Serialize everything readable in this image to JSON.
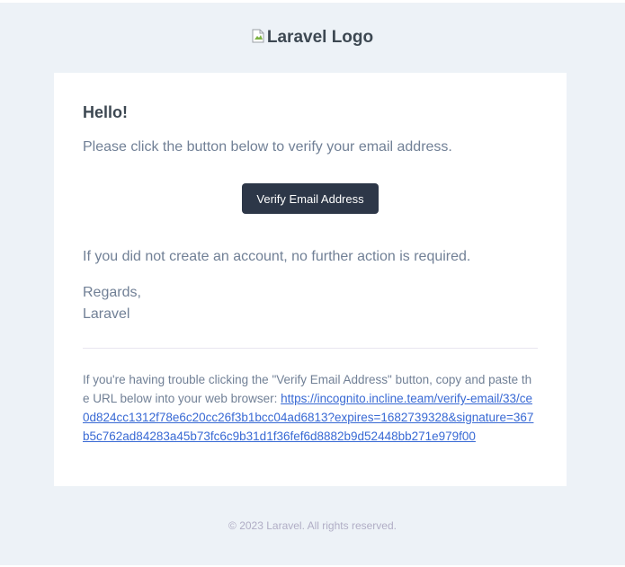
{
  "header": {
    "logo_alt": "Laravel Logo"
  },
  "content": {
    "greeting": "Hello!",
    "intro": "Please click the button below to verify your email address.",
    "button_label": "Verify Email Address",
    "outro": "If you did not create an account, no further action is required.",
    "salutation": "Regards,",
    "signature": "Laravel"
  },
  "subcopy": {
    "text": "If you're having trouble clicking the \"Verify Email Address\" button, copy and paste the URL below into your web browser: ",
    "url": "https://incognito.incline.team/verify-email/33/ce0d824cc1312f78e6c20cc26f3b1bcc04ad6813?expires=1682739328&signature=367b5c762ad84283a45b73fc6c9b31d1f36fef6d8882b9d52448bb271e979f00"
  },
  "footer": {
    "copyright": "© 2023 Laravel. All rights reserved."
  },
  "colors": {
    "background": "#edf2f7",
    "button": "#2d3748",
    "link": "#3869d4",
    "text": "#718096",
    "heading": "#3d4852"
  }
}
